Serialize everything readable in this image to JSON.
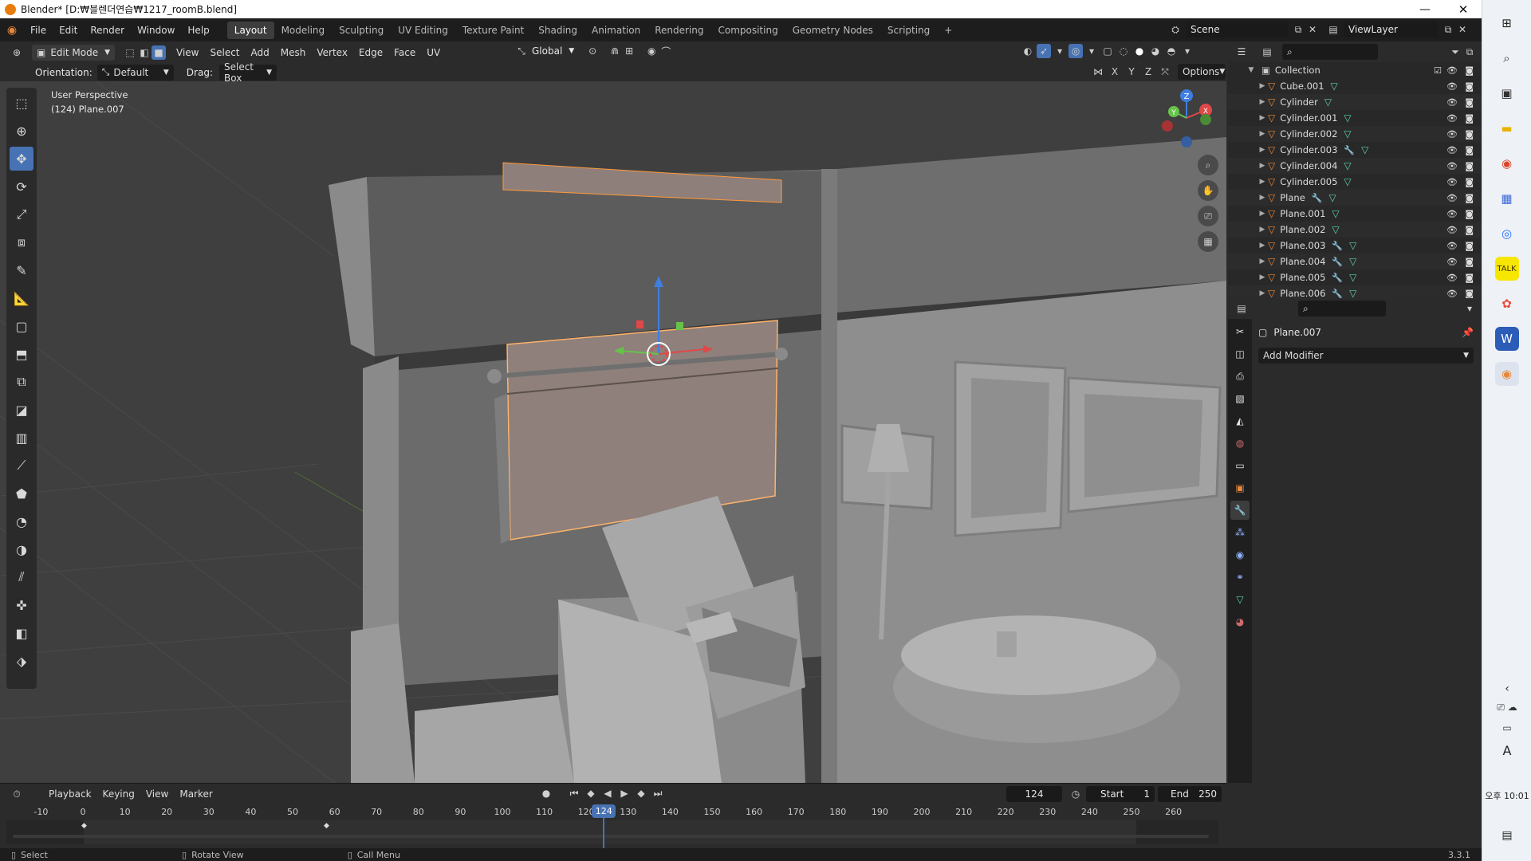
{
  "window": {
    "title": "Blender* [D:₩블렌더연습₩1217_roomB.blend]"
  },
  "menus": [
    "File",
    "Edit",
    "Render",
    "Window",
    "Help"
  ],
  "workspaces": [
    "Layout",
    "Modeling",
    "Sculpting",
    "UV Editing",
    "Texture Paint",
    "Shading",
    "Animation",
    "Rendering",
    "Compositing",
    "Geometry Nodes",
    "Scripting"
  ],
  "active_workspace": "Layout",
  "scene": {
    "label": "Scene",
    "view_layer": "ViewLayer"
  },
  "header": {
    "mode": "Edit Mode",
    "menus": [
      "View",
      "Select",
      "Add",
      "Mesh",
      "Vertex",
      "Edge",
      "Face",
      "UV"
    ],
    "transform": "Global",
    "orientation_label": "Orientation:",
    "orientation_value": "Default",
    "drag_label": "Drag:",
    "drag_value": "Select Box",
    "axes": [
      "X",
      "Y",
      "Z"
    ],
    "options": "Options"
  },
  "viewport": {
    "perspective": "User Perspective",
    "object_info": "(124) Plane.007",
    "gizmo_axes": [
      "Z",
      "Y",
      "X"
    ]
  },
  "outliner": {
    "collection": "Collection",
    "items": [
      {
        "name": "Cube.001",
        "modifier": false
      },
      {
        "name": "Cylinder",
        "modifier": false
      },
      {
        "name": "Cylinder.001",
        "modifier": false
      },
      {
        "name": "Cylinder.002",
        "modifier": false
      },
      {
        "name": "Cylinder.003",
        "modifier": true
      },
      {
        "name": "Cylinder.004",
        "modifier": false
      },
      {
        "name": "Cylinder.005",
        "modifier": false
      },
      {
        "name": "Plane",
        "modifier": true
      },
      {
        "name": "Plane.001",
        "modifier": false
      },
      {
        "name": "Plane.002",
        "modifier": false
      },
      {
        "name": "Plane.003",
        "modifier": true
      },
      {
        "name": "Plane.004",
        "modifier": true
      },
      {
        "name": "Plane.005",
        "modifier": true
      },
      {
        "name": "Plane.006",
        "modifier": true
      }
    ]
  },
  "properties": {
    "object": "Plane.007",
    "add_modifier": "Add Modifier"
  },
  "timeline": {
    "menus": [
      "Playback",
      "Keying",
      "View",
      "Marker"
    ],
    "current_frame": "124",
    "start_label": "Start",
    "start": "1",
    "end_label": "End",
    "end": "250",
    "ticks": [
      "-10",
      "0",
      "10",
      "20",
      "30",
      "40",
      "50",
      "60",
      "70",
      "80",
      "90",
      "100",
      "110",
      "120",
      "130",
      "140",
      "150",
      "160",
      "170",
      "180",
      "190",
      "200",
      "210",
      "220",
      "230",
      "240",
      "250",
      "260"
    ],
    "playhead_label": "124"
  },
  "status": {
    "select": "Select",
    "rotate": "Rotate View",
    "call_menu": "Call Menu",
    "version": "3.3.1"
  },
  "taskbar": {
    "time": "오후 10:01",
    "lang": "A"
  },
  "colors": {
    "accent": "#4772b3",
    "selection": "#ff9a3c",
    "mesh_icon": "#e8873a",
    "modifier_icon": "#8fb2ff",
    "data_icon": "#5fd1b4"
  }
}
